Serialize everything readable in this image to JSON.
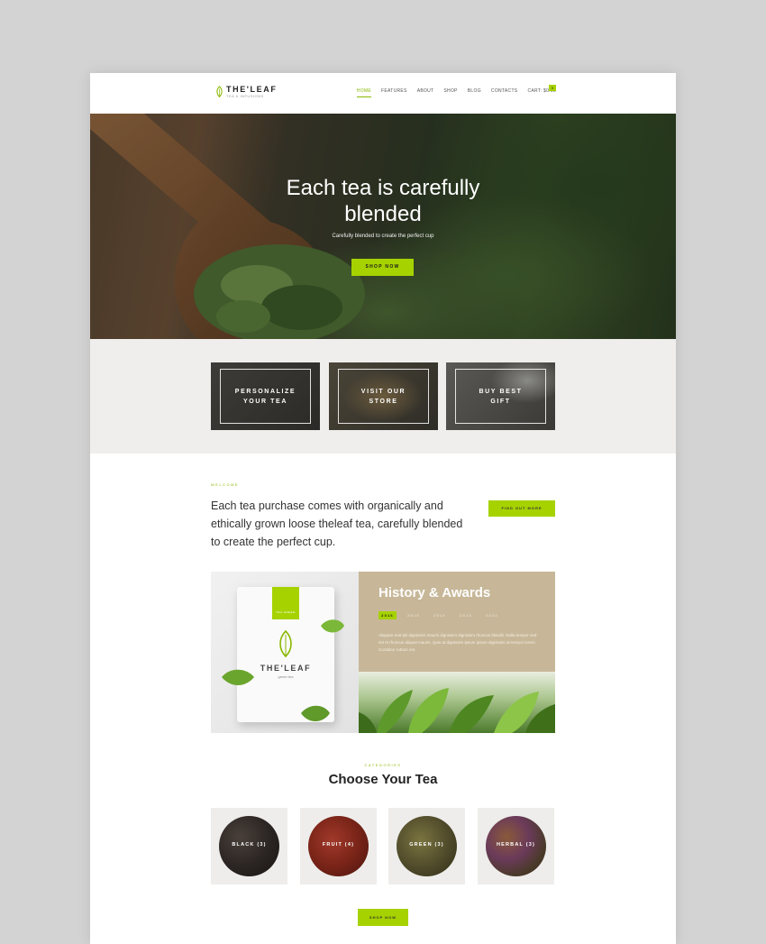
{
  "header": {
    "logo_title": "THE'LEAF",
    "logo_sub": "TEA & INFUSIONS",
    "nav": [
      {
        "label": "HOME"
      },
      {
        "label": "FEATURES"
      },
      {
        "label": "ABOUT"
      },
      {
        "label": "SHOP"
      },
      {
        "label": "BLOG"
      },
      {
        "label": "CONTACTS"
      },
      {
        "label": "CART: $0.00"
      }
    ],
    "cart_count": "0"
  },
  "hero": {
    "title_line1": "Each tea is carefully",
    "title_line2": "blended",
    "subtitle": "Carefully blended to create the perfect cup",
    "button": "SHOP NOW"
  },
  "features": [
    {
      "label": "PERSONALIZE\nYOUR TEA"
    },
    {
      "label": "VISIT OUR\nSTORE"
    },
    {
      "label": "BUY BEST\nGIFT"
    }
  ],
  "welcome": {
    "kicker": "WELCOME",
    "text": "Each tea purchase comes with organically and ethically grown loose theleaf tea, carefully blended to create the perfect cup.",
    "button": "FIND OUT MORE"
  },
  "history": {
    "title": "History & Awards",
    "tabs": [
      "2016",
      "2015",
      "2014",
      "2013",
      "2012"
    ],
    "active_tab": "2016",
    "copy": "Aliquam erat ipk dignissim mauris dignissim dignissim rhoncus blandit. Nulla tempor sed est et rhoncus aliquet mauris. Quis at dignissim ipsum ipsum dignissim at tempor lorem. Curabitur rutrum est."
  },
  "pouch": {
    "tag": "TEA GREEN",
    "brand": "THE'LEAF",
    "sub": "green tea"
  },
  "choose": {
    "kicker": "CATEGORIES",
    "title": "Choose Your Tea",
    "teas": [
      {
        "label": "BLACK (3)"
      },
      {
        "label": "FRUIT (4)"
      },
      {
        "label": "GREEN (3)"
      },
      {
        "label": "HERBAL (3)"
      }
    ],
    "button": "SHOP NOW"
  },
  "colors": {
    "accent": "#a6d200",
    "hero_dark": "#2f3a26",
    "history_panel": "#c7b798",
    "section_bg": "#efeeec"
  }
}
